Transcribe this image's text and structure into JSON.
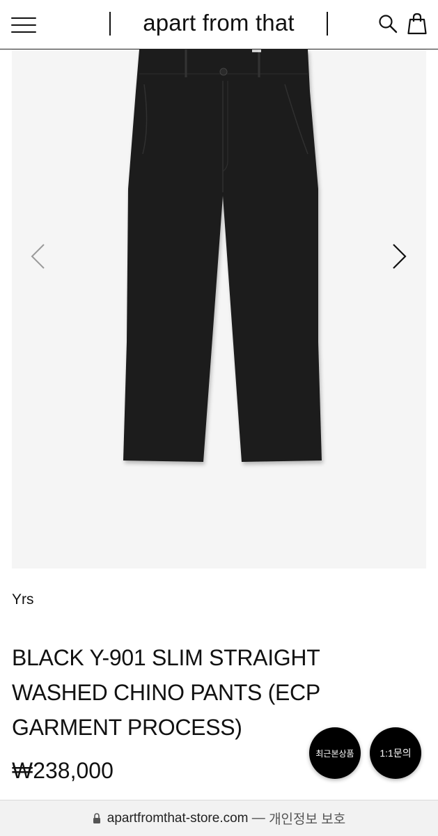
{
  "header": {
    "logo": "apart from that",
    "icons": {
      "menu": "hamburger-menu-icon",
      "search": "search-icon",
      "cart": "shopping-bag-icon"
    }
  },
  "gallery": {
    "background": "#f5f5f5",
    "product_color": "#1a1a1a",
    "prev": "chevron-left-icon",
    "next": "chevron-right-icon"
  },
  "product": {
    "brand": "Yrs",
    "title": "BLACK Y-901 SLIM STRAIGHT WASHED CHINO PANTS (ECP GARMENT PROCESS)",
    "price": "₩238,000"
  },
  "floating_buttons": {
    "recent": "최근본상품",
    "inquiry": "1:1문의"
  },
  "browser": {
    "url": "apartfromthat-store.com",
    "separator": " — ",
    "privacy": "개인정보 보호"
  }
}
